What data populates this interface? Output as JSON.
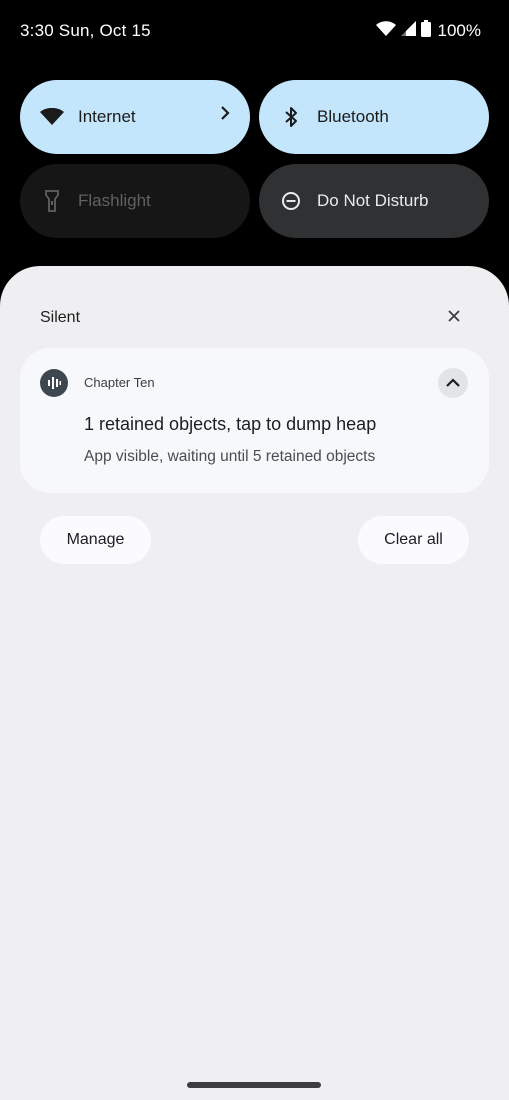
{
  "status_bar": {
    "time_date": "3:30 Sun, Oct 15",
    "battery": "100%"
  },
  "quick_settings": {
    "tiles": [
      {
        "label": "Internet",
        "icon": "wifi-icon",
        "state": "on"
      },
      {
        "label": "Bluetooth",
        "icon": "bluetooth-icon",
        "state": "on"
      },
      {
        "label": "Flashlight",
        "icon": "flashlight-icon",
        "state": "unavailable"
      },
      {
        "label": "Do Not Disturb",
        "icon": "do-not-disturb-icon",
        "state": "off"
      }
    ]
  },
  "notifications": {
    "section_label": "Silent",
    "items": [
      {
        "app_name": "Chapter Ten",
        "title": "1 retained objects, tap to dump heap",
        "text": "App visible, waiting until 5 retained objects"
      }
    ],
    "manage_label": "Manage",
    "clear_all_label": "Clear all"
  },
  "colors": {
    "tile_on": "#c3e6fc",
    "tile_off": "#2f3133",
    "shade_bg": "#efeff2",
    "notification_bg": "#f7f8fb"
  }
}
